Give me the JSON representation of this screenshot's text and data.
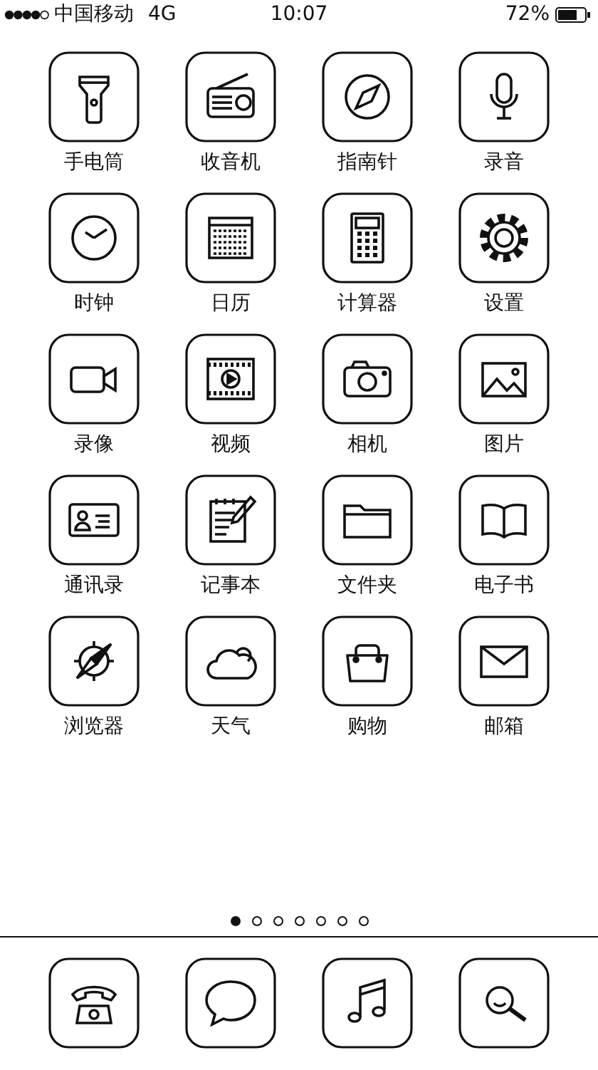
{
  "status_bar": {
    "carrier": "中国移动",
    "network": "4G",
    "time": "10:07",
    "battery": "72%"
  },
  "apps": [
    {
      "label": "手电筒"
    },
    {
      "label": "收音机"
    },
    {
      "label": "指南针"
    },
    {
      "label": "录音"
    },
    {
      "label": "时钟"
    },
    {
      "label": "日历"
    },
    {
      "label": "计算器"
    },
    {
      "label": "设置"
    },
    {
      "label": "录像"
    },
    {
      "label": "视频"
    },
    {
      "label": "相机"
    },
    {
      "label": "图片"
    },
    {
      "label": "通讯录"
    },
    {
      "label": "记事本"
    },
    {
      "label": "文件夹"
    },
    {
      "label": "电子书"
    },
    {
      "label": "浏览器"
    },
    {
      "label": "天气"
    },
    {
      "label": "购物"
    },
    {
      "label": "邮箱"
    }
  ],
  "page_indicator": [
    {
      "selected": true
    },
    {
      "selected": false
    },
    {
      "selected": false
    },
    {
      "selected": false
    },
    {
      "selected": false
    },
    {
      "selected": false
    },
    {
      "selected": false
    }
  ]
}
